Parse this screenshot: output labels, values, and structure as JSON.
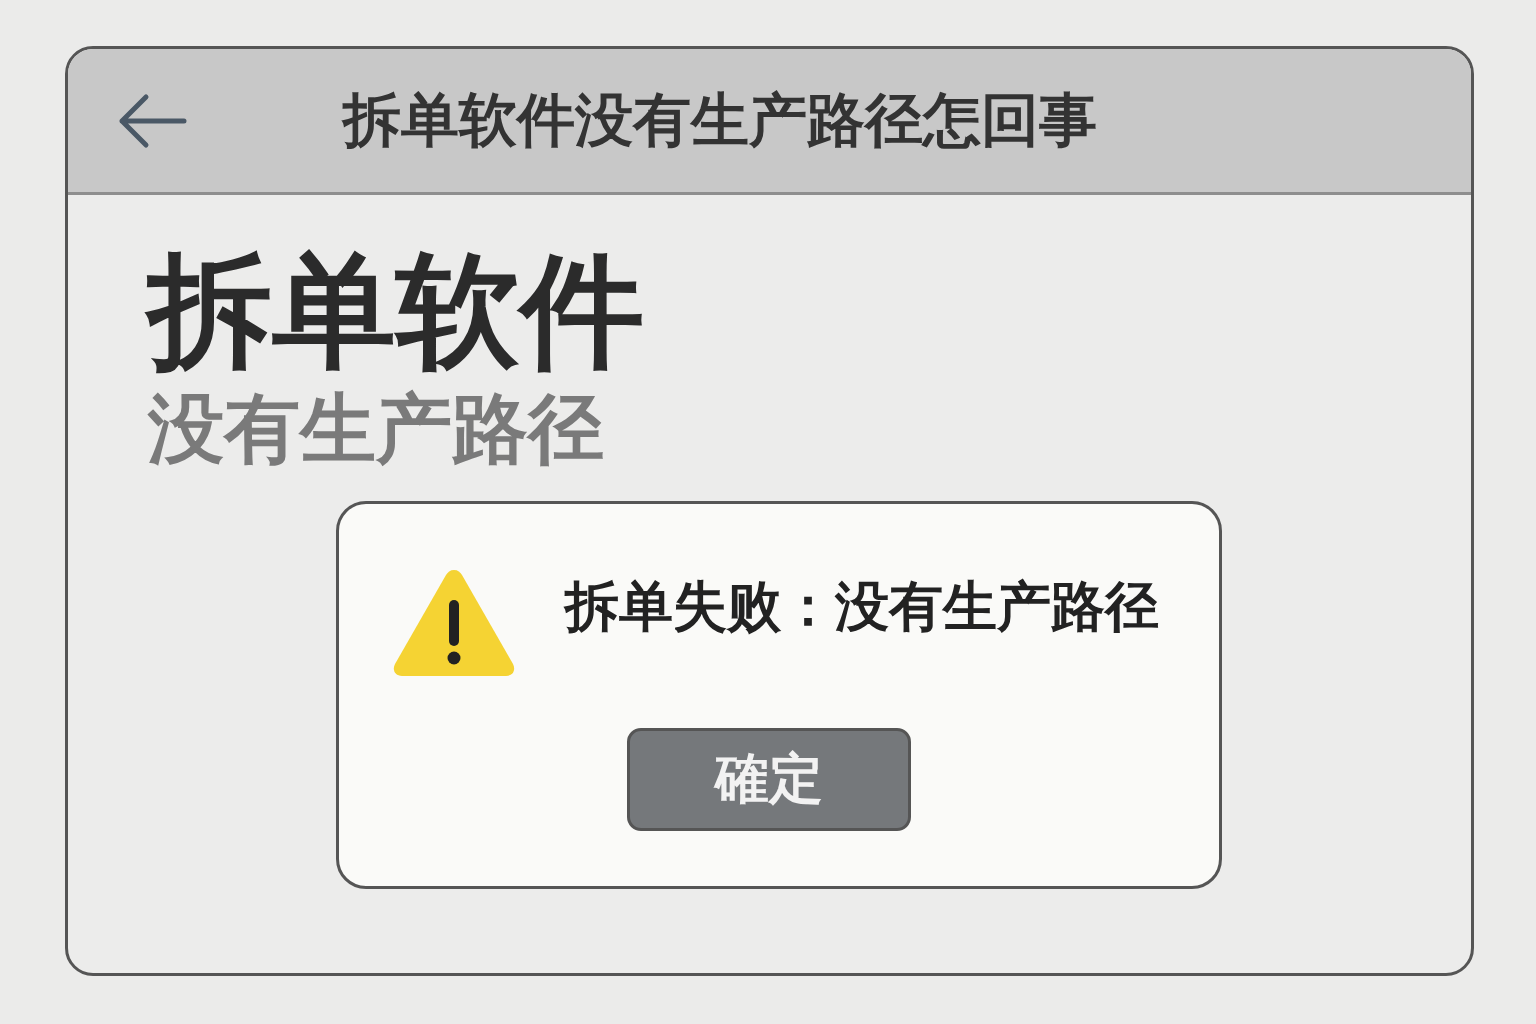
{
  "header": {
    "title": "拆单软件没有生产路径怎回事"
  },
  "content": {
    "heading": "拆单软件",
    "subheading": "没有生产路径"
  },
  "dialog": {
    "message": "拆单失败：没有生产路径",
    "buttons": [
      "確定"
    ]
  }
}
